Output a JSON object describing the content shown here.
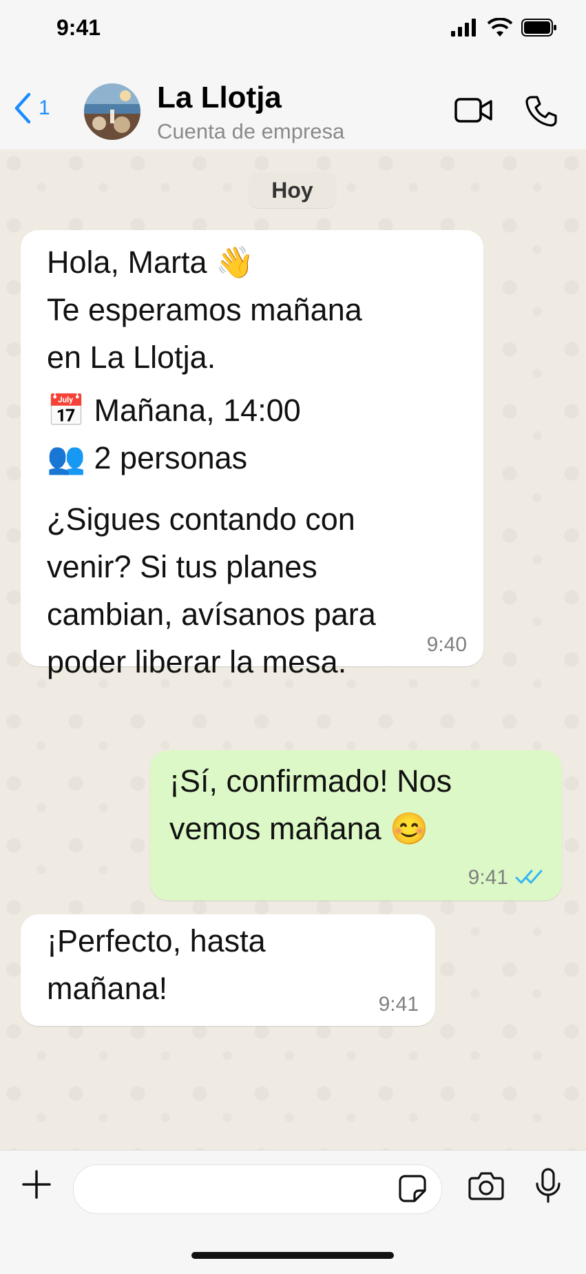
{
  "status_bar": {
    "time": "9:41"
  },
  "header": {
    "back_count": "1",
    "contact_name": "La Llotja",
    "contact_subtitle": "Cuenta de empresa"
  },
  "chat": {
    "date_divider": "Hoy",
    "messages": [
      {
        "direction": "incoming",
        "lines": [
          "Hola, Marta 👋",
          "Te esperamos mañana",
          "en La Llotja.",
          "📅 Mañana, 14:00",
          "👥 2 personas",
          "¿Sigues contando con",
          "venir? Si tus planes",
          "cambian, avísanos para",
          "poder liberar la mesa."
        ],
        "time": "9:40"
      },
      {
        "direction": "outgoing",
        "lines": [
          "¡Sí, confirmado! Nos",
          "vemos mañana 😊"
        ],
        "time": "9:41",
        "status": "read"
      },
      {
        "direction": "incoming",
        "lines": [
          "¡Perfecto, hasta",
          "mañana!"
        ],
        "time": "9:41"
      }
    ]
  },
  "composer": {
    "placeholder": ""
  },
  "colors": {
    "accent_blue": "#1a8cff",
    "outgoing_bubble": "#dcf8c6",
    "incoming_bubble": "#ffffff",
    "chat_background": "#efeae2",
    "read_ticks": "#34b7f1"
  }
}
